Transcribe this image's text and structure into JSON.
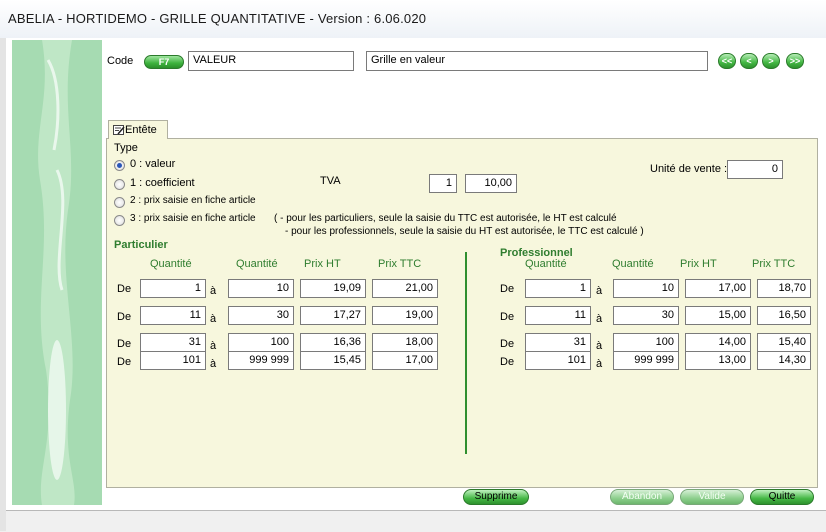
{
  "window": {
    "title": "ABELIA  -  HORTIDEMO  -  GRILLE QUANTITATIVE  -  Version : 6.06.020"
  },
  "header": {
    "code_label": "Code",
    "f7_button": "F7",
    "code_value": "VALEUR",
    "description_value": "Grille en valeur",
    "nav": {
      "first": "<<",
      "prev": "<",
      "next": ">",
      "last": ">>"
    }
  },
  "tab": {
    "label": "Entête"
  },
  "type_section": {
    "label": "Type",
    "options": [
      {
        "label": "0 : valeur",
        "selected": true
      },
      {
        "label": "1 : coefficient",
        "selected": false
      },
      {
        "label": "2 : prix saisie en fiche article",
        "selected": false
      },
      {
        "label": "3 : prix saisie en fiche article",
        "selected": false
      }
    ],
    "note_line1": "( - pour les particuliers, seule la saisie du TTC est autorisée, le HT est calculé",
    "note_line2": "- pour les professionnels, seule la saisie du HT est autorisée, le TTC est calculé )"
  },
  "tva": {
    "label": "TVA",
    "code": "1",
    "rate": "10,00"
  },
  "unite_vente": {
    "label": "Unité de vente :",
    "value": "0"
  },
  "particulier": {
    "title": "Particulier",
    "headers": {
      "q_from": "Quantité",
      "q_to": "Quantité",
      "ht": "Prix HT",
      "ttc": "Prix TTC"
    },
    "rows": [
      {
        "de": "De",
        "from": "1",
        "a": "à",
        "to": "10",
        "ht": "19,09",
        "ttc": "21,00"
      },
      {
        "de": "De",
        "from": "11",
        "a": "à",
        "to": "30",
        "ht": "17,27",
        "ttc": "19,00"
      },
      {
        "de": "De",
        "from": "31",
        "a": "à",
        "to": "100",
        "ht": "16,36",
        "ttc": "18,00"
      },
      {
        "de": "De",
        "from": "101",
        "a": "à",
        "to": "999 999",
        "ht": "15,45",
        "ttc": "17,00"
      }
    ]
  },
  "professionnel": {
    "title": "Professionnel",
    "headers": {
      "q_from": "Quantité",
      "q_to": "Quantité",
      "ht": "Prix HT",
      "ttc": "Prix TTC"
    },
    "rows": [
      {
        "de": "De",
        "from": "1",
        "a": "à",
        "to": "10",
        "ht": "17,00",
        "ttc": "18,70"
      },
      {
        "de": "De",
        "from": "11",
        "a": "à",
        "to": "30",
        "ht": "15,00",
        "ttc": "16,50"
      },
      {
        "de": "De",
        "from": "31",
        "a": "à",
        "to": "100",
        "ht": "14,00",
        "ttc": "15,40"
      },
      {
        "de": "De",
        "from": "101",
        "a": "à",
        "to": "999 999",
        "ht": "13,00",
        "ttc": "14,30"
      }
    ]
  },
  "actions": {
    "supprime": "Supprime",
    "abandon": "Abandon",
    "valide": "Valide",
    "quitte": "Quitte"
  },
  "colors": {
    "accent_green": "#3db23d",
    "panel_bg": "#f7f7dd",
    "section_green": "#2f7d2f",
    "divider_green": "#2f8f2f",
    "decor_green": "#b9e4c2"
  }
}
